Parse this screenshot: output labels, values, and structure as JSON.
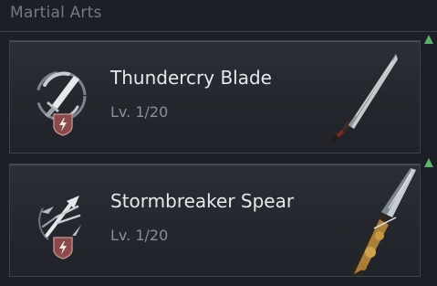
{
  "header": {
    "title": "Martial Arts"
  },
  "skills": [
    {
      "name": "Thundercry Blade",
      "level": "Lv. 1/20",
      "icon": "blade-skill-icon",
      "weapon": "sword-image"
    },
    {
      "name": "Stormbreaker Spear",
      "level": "Lv. 1/20",
      "icon": "spear-skill-icon",
      "weapon": "spear-image"
    }
  ],
  "colors": {
    "background": "#1c1f25",
    "card": "#2b2f36",
    "upgrade_arrow": "#59b46a",
    "badge": "#8a4a4a"
  }
}
